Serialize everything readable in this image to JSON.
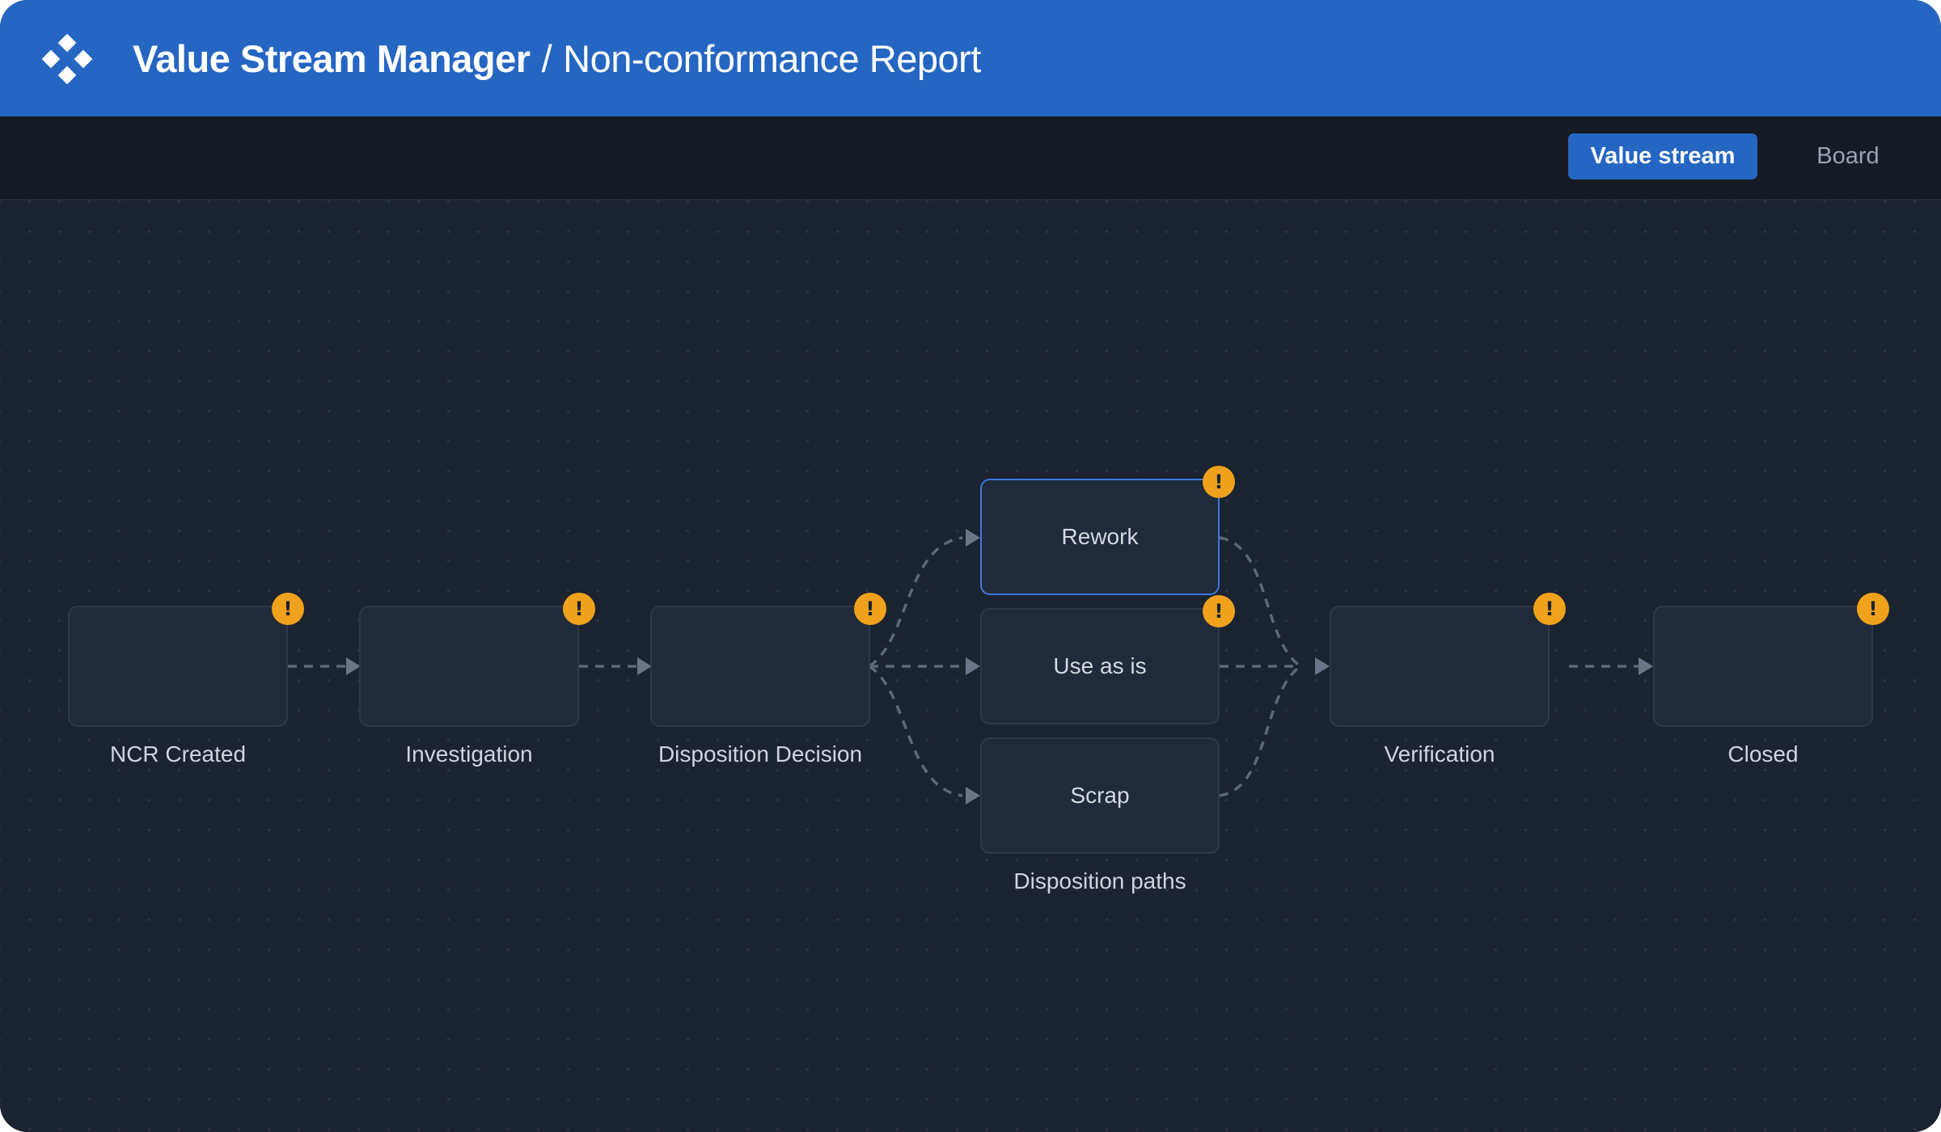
{
  "header": {
    "app_name": "Value Stream Manager",
    "separator": "/",
    "page_title": "Non-conformance Report",
    "logo_icon": "diamond-cluster-logo-icon"
  },
  "toolbar": {
    "views": [
      {
        "label": "Value stream",
        "active": true
      },
      {
        "label": "Board",
        "active": false
      }
    ]
  },
  "stages": [
    {
      "label": "NCR Created",
      "warning_icon": "exclamation-icon",
      "warning_glyph": "!"
    },
    {
      "label": "Investigation",
      "warning_icon": "exclamation-icon",
      "warning_glyph": "!"
    },
    {
      "label": "Disposition Decision",
      "warning_icon": "exclamation-icon",
      "warning_glyph": "!"
    },
    {
      "label": "Verification",
      "warning_icon": "exclamation-icon",
      "warning_glyph": "!"
    },
    {
      "label": "Closed",
      "warning_icon": "exclamation-icon",
      "warning_glyph": "!"
    }
  ],
  "disposition": {
    "group_label": "Disposition paths",
    "paths": [
      {
        "label": "Rework",
        "selected": true,
        "warning_glyph": "!"
      },
      {
        "label": "Use as is",
        "selected": false,
        "warning_glyph": "!"
      },
      {
        "label": "Scrap",
        "selected": false,
        "warning_glyph": null
      }
    ]
  },
  "colors": {
    "header": "#2566c2",
    "canvas": "#1b2230",
    "warning": "#f0a21d",
    "selected_border": "#3b79de",
    "edge": "#5d6779"
  }
}
